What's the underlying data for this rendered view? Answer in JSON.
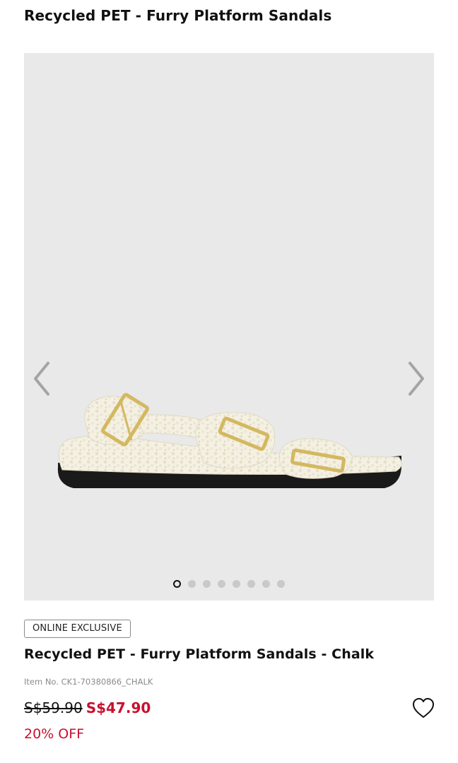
{
  "header": {
    "title": "Recycled PET - Furry Platform Sandals"
  },
  "gallery": {
    "previous_icon": "chevron-left-icon",
    "next_icon": "chevron-right-icon",
    "image_count": 8,
    "active_index": 0,
    "colors": {
      "background": "#e9e9ea",
      "fur": "#f4f0e2",
      "sole": "#1a1a1a",
      "buckle": "#d4b860"
    }
  },
  "product": {
    "badge": "ONLINE EXCLUSIVE",
    "name": "Recycled PET - Furry Platform Sandals - Chalk",
    "item_no": "Item No. CK1-70380866_CHALK",
    "original_price": "S$59.90",
    "sale_price": "S$47.90",
    "discount": "20% OFF",
    "sale_color": "#c8102e",
    "wishlist_icon": "heart-icon"
  }
}
